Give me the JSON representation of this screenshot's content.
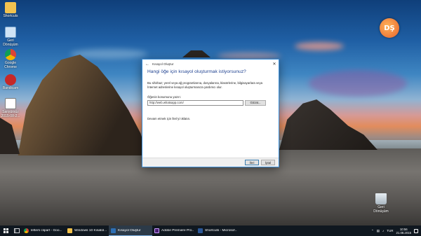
{
  "desktop": {
    "icons": [
      {
        "label": "Shortcuts",
        "icon": "folder-icon"
      },
      {
        "label": "Geri Dönüşüm",
        "icon": "pc-icon"
      },
      {
        "label": "Google Chrome",
        "icon": "chrome-icon"
      },
      {
        "label": "Bandicam",
        "icon": "bandicam-icon"
      },
      {
        "label": "Sansürsüz 2015-08-2...",
        "icon": "document-icon"
      }
    ],
    "recycle_bin_label": "Geri Dönüşüm",
    "logo_text": "DŞ"
  },
  "dialog": {
    "title": "Kısayol Oluştur",
    "heading": "Hangi öğe için kısayol oluşturmak istiyorsunuz?",
    "description": "Bu sihirbaz; yerel veya ağ programlarına, dosyalarına, klasörlerine, bilgisayarlara veya İnternet adreslerine kısayol oluşturmanıza yardımcı olur.",
    "location_label": "Öğenin konumunu yazın:",
    "location_value": "http://web.whatsapp.com/",
    "browse_label": "Gözat...",
    "continue_text": "Devam etmek için İleri'yi tıklatın.",
    "next_label": "İleri",
    "cancel_label": "İptal"
  },
  "taskbar": {
    "buttons": [
      {
        "label": "letters clipart - Goo...",
        "color": "#e0462a",
        "active": false
      },
      {
        "label": "Windows 10 Kısatol...",
        "color": "#f3c24b",
        "active": false
      },
      {
        "label": "Kısayol Oluştur",
        "color": "#2d6fb5",
        "active": true
      },
      {
        "label": "Adobe Premiere Pro...",
        "color": "#4a1e73",
        "active": false
      },
      {
        "label": "Shortcuts - Microsof...",
        "color": "#2b5797",
        "active": false
      }
    ],
    "language": "TUR",
    "time": "10:56",
    "date": "21.08.2015"
  }
}
